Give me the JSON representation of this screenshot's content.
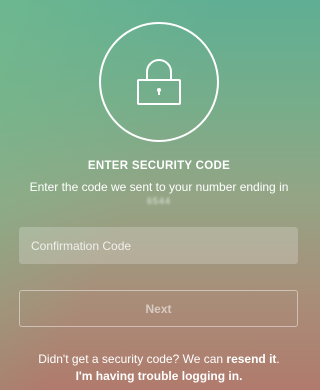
{
  "icon": {
    "name": "lock-icon",
    "color": "#ffffff"
  },
  "heading": {
    "title": "ENTER SECURITY CODE",
    "instruction": "Enter the code we sent to your number ending in",
    "phone_suffix": "6544"
  },
  "form": {
    "code_placeholder": "Confirmation Code",
    "code_value": "",
    "next_label": "Next"
  },
  "footer": {
    "resend_prompt": "Didn't get a security code? We can ",
    "resend_link": "resend it",
    "resend_end": ".",
    "trouble_link": "I'm having trouble logging in."
  }
}
